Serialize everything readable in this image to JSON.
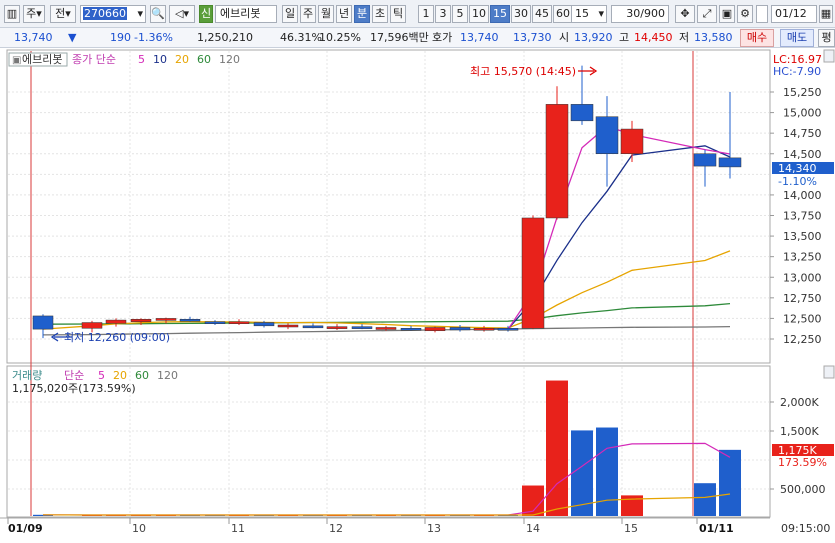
{
  "toolbar": {
    "market_label": "주",
    "prev_label": "전",
    "code": "270660",
    "badge": "신",
    "stock_name": "에브리봇",
    "periods": [
      "일",
      "주",
      "월",
      "년",
      "분",
      "초",
      "틱"
    ],
    "active_period": "분",
    "intervals": [
      "1",
      "3",
      "5",
      "10",
      "15",
      "30",
      "45",
      "60"
    ],
    "active_interval": "15",
    "interval_value": "15",
    "count": "30/900",
    "date": "01/12"
  },
  "quote": {
    "price": "13,740",
    "change": "190",
    "change_rate": "-1.36%",
    "volume": "1,250,210",
    "vol_ratio": "46.31%",
    "turnover": "10.25%",
    "amount": "17,596백만",
    "ask_label": "호가",
    "ask": "13,740",
    "bid": "13,730",
    "open_label": "시",
    "open": "13,920",
    "high_label": "고",
    "high": "14,450",
    "low_label": "저",
    "low": "13,580",
    "buy_label": "매수",
    "sell_label": "매도",
    "extra_label": "평"
  },
  "price_panel": {
    "legend_name": "에브리봇",
    "legend_ma": "종가 단순",
    "ma_periods": [
      "5",
      "10",
      "20",
      "60",
      "120"
    ],
    "lc": "LC:16.97",
    "hc": "HC:-7.90",
    "high_note": "최고 15,570 (14:45)",
    "low_note": "최저 12,260 (09:00)",
    "current_price": "14,340",
    "current_change": "-1.10%",
    "y_ticks": [
      "15,250",
      "15,000",
      "14,750",
      "14,500",
      "14,250",
      "14,000",
      "13,750",
      "13,500",
      "13,250",
      "13,000",
      "12,750",
      "12,500",
      "12,250"
    ]
  },
  "volume_panel": {
    "legend_name": "거래량",
    "legend_ma": "단순",
    "ma_periods": [
      "5",
      "20",
      "60",
      "120"
    ],
    "summary": "1,175,020주(173.59%)",
    "current_volume": "1,175K",
    "current_ratio": "173.59%",
    "y_ticks": [
      "2,000K",
      "1,500K",
      "1,000K",
      "500,000"
    ]
  },
  "x_axis": {
    "labels": [
      "01/09",
      "10",
      "11",
      "12",
      "13",
      "14",
      "15",
      "01/11"
    ],
    "time": "09:15:00"
  },
  "colors": {
    "up": "#e8221b",
    "down": "#1f5fcc",
    "ma5": "#d42ab8",
    "ma10": "#1a2f8a",
    "ma20": "#e6a400",
    "ma60": "#2e8a3a",
    "ma120": "#777777",
    "divider": "#d83a3a"
  },
  "chart_data": {
    "type": "candlestick",
    "unit": "KRW",
    "interval": "15min",
    "candles": [
      {
        "t": "01/09 09:00",
        "o": 12530,
        "h": 12550,
        "l": 12260,
        "c": 12370
      },
      {
        "t": "01/09 10:00",
        "o": 12380,
        "h": 12470,
        "l": 12330,
        "c": 12450
      },
      {
        "t": "01/09 11:00",
        "o": 12440,
        "h": 12500,
        "l": 12400,
        "c": 12480
      },
      {
        "t": "01/09 12:00",
        "o": 12460,
        "h": 12500,
        "l": 12420,
        "c": 12490
      },
      {
        "t": "01/09 13:00",
        "o": 12480,
        "h": 12510,
        "l": 12440,
        "c": 12500
      },
      {
        "t": "01/09 14:00",
        "o": 12490,
        "h": 12520,
        "l": 12460,
        "c": 12470
      },
      {
        "t": "01/09 15:00",
        "o": 12460,
        "h": 12480,
        "l": 12420,
        "c": 12440
      },
      {
        "t": "01/10 09:00",
        "o": 12450,
        "h": 12490,
        "l": 12420,
        "c": 12460
      },
      {
        "t": "01/10 10:00",
        "o": 12450,
        "h": 12470,
        "l": 12390,
        "c": 12410
      },
      {
        "t": "01/10 11:00",
        "o": 12400,
        "h": 12440,
        "l": 12370,
        "c": 12420
      },
      {
        "t": "01/10 12:00",
        "o": 12410,
        "h": 12440,
        "l": 12380,
        "c": 12390
      },
      {
        "t": "01/10 13:00",
        "o": 12390,
        "h": 12430,
        "l": 12360,
        "c": 12400
      },
      {
        "t": "01/10 14:00",
        "o": 12400,
        "h": 12430,
        "l": 12370,
        "c": 12380
      },
      {
        "t": "01/10 15:00",
        "o": 12370,
        "h": 12410,
        "l": 12350,
        "c": 12390
      },
      {
        "t": "01/10 15:15",
        "o": 12380,
        "h": 12410,
        "l": 12350,
        "c": 12360
      },
      {
        "t": "01/10 15:30",
        "o": 12350,
        "h": 12400,
        "l": 12330,
        "c": 12390
      },
      {
        "t": "01/10 15:45",
        "o": 12390,
        "h": 12420,
        "l": 12340,
        "c": 12360
      },
      {
        "t": "01/10 16:00",
        "o": 12370,
        "h": 12410,
        "l": 12340,
        "c": 12380
      },
      {
        "t": "01/10 16:15",
        "o": 12380,
        "h": 12410,
        "l": 12340,
        "c": 12360
      },
      {
        "t": "01/11 09:00",
        "o": 12380,
        "h": 13750,
        "l": 12370,
        "c": 13720
      },
      {
        "t": "01/11 09:15",
        "o": 13720,
        "h": 15320,
        "l": 13700,
        "c": 15100
      },
      {
        "t": "01/11 09:30",
        "o": 15100,
        "h": 15570,
        "l": 14850,
        "c": 14900
      },
      {
        "t": "01/11 09:45",
        "o": 14950,
        "h": 15200,
        "l": 14100,
        "c": 14500
      },
      {
        "t": "01/11 10:00",
        "o": 14500,
        "h": 14900,
        "l": 14400,
        "c": 14800
      },
      {
        "t": "01/11 10:15",
        "o": 14500,
        "h": 14550,
        "l": 14100,
        "c": 14350
      },
      {
        "t": "01/11 10:30",
        "o": 14450,
        "h": 15250,
        "l": 14200,
        "c": 14340
      }
    ],
    "volume": [
      55000,
      20000,
      12000,
      10000,
      15000,
      8000,
      9000,
      14000,
      11000,
      10000,
      9000,
      8000,
      9000,
      8000,
      9000,
      7000,
      8000,
      7000,
      8000,
      560000,
      2370000,
      1510000,
      1560000,
      390000,
      600000,
      1175020
    ]
  }
}
